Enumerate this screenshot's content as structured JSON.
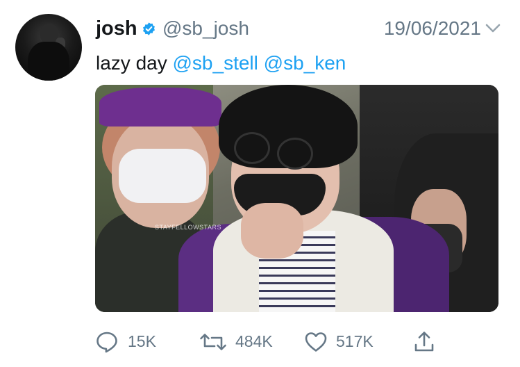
{
  "tweet": {
    "author_name": "josh",
    "handle": "@sb_josh",
    "date": "19/06/2021",
    "text_plain": "lazy day",
    "mentions": [
      "@sb_stell",
      "@sb_ken"
    ],
    "media_watermark": "STAYFELLOWSTARS"
  },
  "actions": {
    "replies": "15K",
    "retweets": "484K",
    "likes": "517K"
  },
  "colors": {
    "mention": "#1da1f2",
    "verified": "#1da1f2",
    "secondary_text": "#657786"
  },
  "icons": {
    "verified": "verified-badge-icon",
    "more": "chevron-down-icon",
    "reply": "reply-icon",
    "retweet": "retweet-icon",
    "like": "heart-icon",
    "share": "share-icon"
  }
}
